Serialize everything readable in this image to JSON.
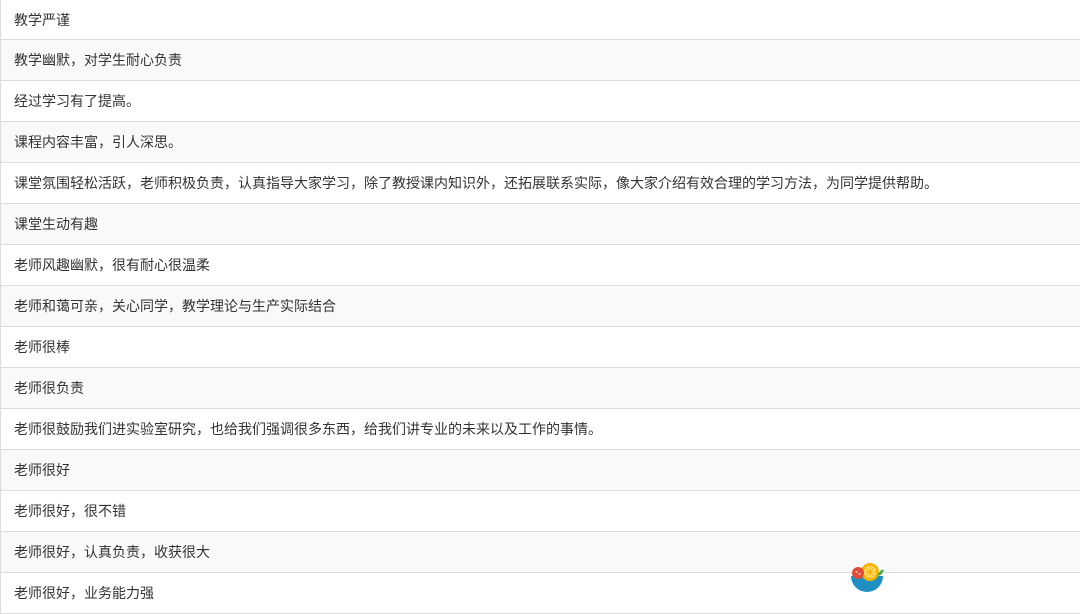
{
  "comments": {
    "rows": [
      "教学严谨",
      "教学幽默，对学生耐心负责",
      "经过学习有了提高。",
      "课程内容丰富，引人深思。",
      "课堂氛围轻松活跃，老师积极负责，认真指导大家学习，除了教授课内知识外，还拓展联系实际，像大家介绍有效合理的学习方法，为同学提供帮助。",
      "课堂生动有趣",
      "老师风趣幽默，很有耐心很温柔",
      "老师和蔼可亲，关心同学，教学理论与生产实际结合",
      "老师很棒",
      "老师很负责",
      "老师很鼓励我们进实验室研究，也给我们强调很多东西，给我们讲专业的未来以及工作的事情。",
      "老师很好",
      "老师很好，很不错",
      "老师很好，认真负责，收获很大",
      "老师很好，业务能力强"
    ]
  },
  "floating_badge": {
    "icon": "food-bowl-icon",
    "colors": {
      "bowl": "#1f8fc2",
      "lemon": "#f5b400",
      "tomato": "#e04a3a",
      "leaf": "#3fae49"
    }
  }
}
